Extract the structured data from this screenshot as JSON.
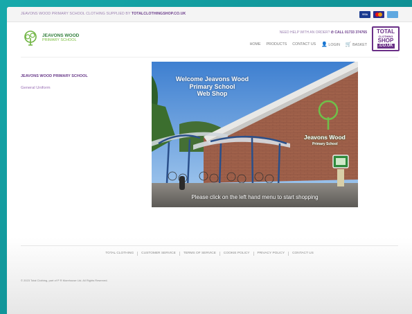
{
  "topbar": {
    "prefix": "JEAVONS WOOD PRIMARY SCHOOL CLOTHING SUPPLIED BY",
    "link": "TOTALCLOTHINGSHOP.CO.UK",
    "payments": [
      "VISA",
      "MASTERCARD",
      "AMEX"
    ]
  },
  "logo": {
    "name": "JEAVONS WOOD",
    "sub": "PRIMARY SCHOOL"
  },
  "header": {
    "help_text": "NEED HELP WITH AN ORDER?",
    "phone": "CALL 01733 374765",
    "nav": [
      "HOME",
      "PRODUCTS",
      "CONTACT US",
      "LOGIN",
      "BASKET"
    ]
  },
  "brand": {
    "line1": "TOTAL",
    "line2": "CLOTHING",
    "line3": "SHOP",
    "line4": ".CO.UK"
  },
  "sidebar": {
    "title": "JEAVONS WOOD PRIMARY SCHOOL",
    "links": [
      "General Uniform"
    ]
  },
  "hero": {
    "title_line1": "Welcome Jeavons Wood",
    "title_line2": "Primary School",
    "title_line3": "Web Shop",
    "sign_line1": "Jeavons Wood",
    "sign_line2": "Primary School",
    "caption": "Please click on the left hand menu to start shopping"
  },
  "footer": {
    "links": [
      "TOTAL CLOTHING",
      "CUSTOMER SERVICE",
      "TERMS OF SERVICE",
      "COOKIE POLICY",
      "PRIVACY POLICY",
      "CONTACT US"
    ],
    "copyright": "© 2023 Total Clothing, part of P R Morehouse Ltd. All Rights Reserved."
  },
  "colors": {
    "purple": "#6a3b8a",
    "teal": "#1aa2a5",
    "green": "#2f7d3a"
  }
}
